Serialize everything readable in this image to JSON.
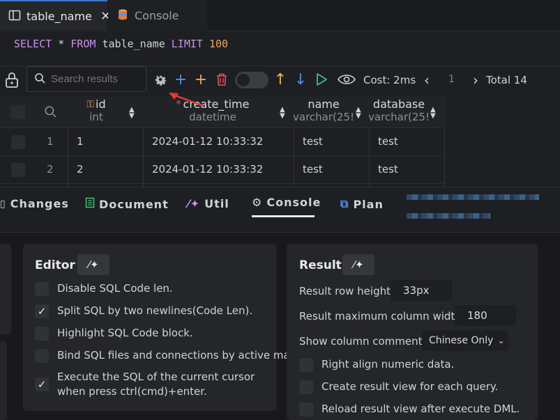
{
  "tabs": [
    {
      "label": "table_name",
      "icon": "table-icon",
      "active": true
    },
    {
      "label": "Console",
      "icon": "database-icon",
      "active": false
    }
  ],
  "sql": {
    "kw_select": "SELECT",
    "star": "*",
    "kw_from": "FROM",
    "table": "table_name",
    "kw_limit": "LIMIT",
    "limit": "100"
  },
  "toolbar": {
    "search_placeholder": "Search results",
    "cost": "Cost: 2ms",
    "page": "1",
    "total": "Total 14",
    "prev_label": "‹",
    "next_label": "›"
  },
  "grid": {
    "columns": [
      {
        "name": "id",
        "type": "int",
        "key": true
      },
      {
        "name": "create_time",
        "type": "datetime",
        "required": true
      },
      {
        "name": "name",
        "type": "varchar(25!"
      },
      {
        "name": "database",
        "type": "varchar(25!"
      }
    ],
    "rows": [
      {
        "n": "1",
        "id": "1",
        "create_time": "2024-01-12 10:33:32",
        "name": "test",
        "database": "test"
      },
      {
        "n": "2",
        "id": "2",
        "create_time": "2024-01-12 10:33:32",
        "name": "test",
        "database": "test"
      }
    ]
  },
  "bottom_tabs": [
    {
      "label": "Changes",
      "icon": "changes-icon"
    },
    {
      "label": "Document",
      "icon": "document-icon"
    },
    {
      "label": "Util",
      "icon": "wand-icon"
    },
    {
      "label": "Console",
      "icon": "gear-icon",
      "active": true
    },
    {
      "label": "Plan",
      "icon": "plan-icon"
    }
  ],
  "editor": {
    "title": "Editor",
    "options": [
      {
        "label": "Disable SQL Code len.",
        "checked": false
      },
      {
        "label": "Split SQL by two newlines(Code Len).",
        "checked": true
      },
      {
        "label": "Highlight SQL Code block.",
        "checked": false
      },
      {
        "label": "Bind SQL files and connections by active mark.",
        "checked": false
      },
      {
        "label": "Execute the SQL of the current cursor when press ctrl(cmd)+enter.",
        "checked": true
      }
    ]
  },
  "result": {
    "title": "Result",
    "row_height_label": "Result row height:",
    "row_height_value": "33px",
    "max_width_label": "Result maximum column width:",
    "max_width_value": "180",
    "comments_label": "Show column comments:",
    "comments_value": "Chinese Only",
    "options": [
      {
        "label": "Right align numeric data.",
        "checked": false
      },
      {
        "label": "Create result view for each query.",
        "checked": false
      },
      {
        "label": "Reload result view after execute DML.",
        "checked": false
      }
    ]
  },
  "colors": {
    "accent": "#3a7bd5",
    "add_blue": "#4f8df0",
    "add_orange": "#f0a35e",
    "delete_red": "#e05a5a",
    "up_yellow": "#e8b84a",
    "run_green": "#3ec27a",
    "annotation_red": "#e53935"
  }
}
